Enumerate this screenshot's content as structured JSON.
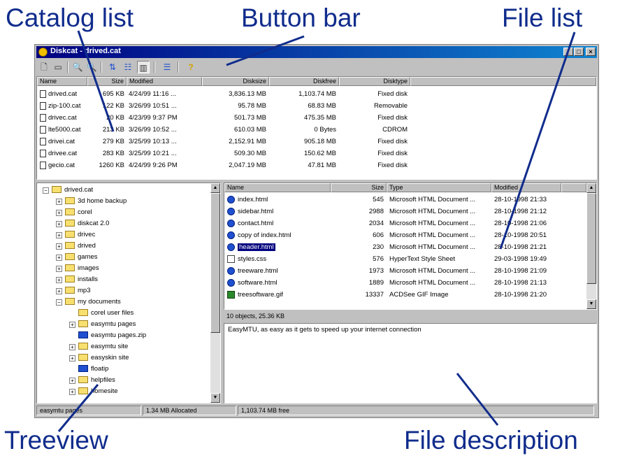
{
  "callouts": {
    "catalog_list": "Catalog list",
    "button_bar": "Button bar",
    "file_list": "File list",
    "treeview": "Treeview",
    "file_description": "File description"
  },
  "window": {
    "title": "Diskcat - drived.cat",
    "minimize": "_",
    "maximize": "□",
    "close": "×"
  },
  "toolbar": {
    "icons": [
      "new-icon",
      "save-icon",
      "search-icon",
      "find-icon",
      "sort-icon",
      "list-view-icon",
      "details-view-icon",
      "options-icon",
      "help-icon"
    ],
    "glyphs": {
      "new": "🗋",
      "save": "▭",
      "search": "🔍",
      "find": "🔍",
      "sort": "⇅",
      "list": "☷",
      "details": "▥",
      "options": "☰",
      "help": "?"
    }
  },
  "catalog": {
    "columns": [
      "Name",
      "Size",
      "Modified",
      "Disksize",
      "Diskfree",
      "Disktype"
    ],
    "rows": [
      {
        "name": "drived.cat",
        "size": "695 KB",
        "modified": "4/24/99 11:16 ...",
        "disksize": "3,836.13 MB",
        "diskfree": "1,103.74 MB",
        "disktype": "Fixed disk"
      },
      {
        "name": "zip-100.cat",
        "size": "122 KB",
        "modified": "3/26/99 10:51 ...",
        "disksize": "95.78 MB",
        "diskfree": "68.83 MB",
        "disktype": "Removable"
      },
      {
        "name": "drivec.cat",
        "size": "20 KB",
        "modified": "4/23/99 9:37 PM",
        "disksize": "501.73 MB",
        "diskfree": "475.35 MB",
        "disktype": "Fixed disk"
      },
      {
        "name": "lte5000.cat",
        "size": "213 KB",
        "modified": "3/26/99 10:52 ...",
        "disksize": "610.03 MB",
        "diskfree": "0 Bytes",
        "disktype": "CDROM"
      },
      {
        "name": "drivei.cat",
        "size": "279 KB",
        "modified": "3/25/99 10:13 ...",
        "disksize": "2,152.91 MB",
        "diskfree": "905.18 MB",
        "disktype": "Fixed disk"
      },
      {
        "name": "drivee.cat",
        "size": "283 KB",
        "modified": "3/25/99 10:21 ...",
        "disksize": "509.30 MB",
        "diskfree": "150.62 MB",
        "disktype": "Fixed disk"
      },
      {
        "name": "gecio.cat",
        "size": "1260 KB",
        "modified": "4/24/99 9:26 PM",
        "disksize": "2,047.19 MB",
        "diskfree": "47.81 MB",
        "disktype": "Fixed disk"
      }
    ]
  },
  "tree": {
    "expander_glyphs": {
      "collapsed": "+",
      "expanded": "−"
    },
    "items": [
      {
        "label": "drived.cat"
      },
      {
        "label": "3d home backup"
      },
      {
        "label": "corel"
      },
      {
        "label": "diskcat 2.0"
      },
      {
        "label": "drivec"
      },
      {
        "label": "drived"
      },
      {
        "label": "games"
      },
      {
        "label": "images"
      },
      {
        "label": "installs"
      },
      {
        "label": "mp3"
      },
      {
        "label": "my documents"
      },
      {
        "label": "corel user files"
      },
      {
        "label": "easymtu pages"
      },
      {
        "label": "easymtu pages.zip"
      },
      {
        "label": "easymtu site"
      },
      {
        "label": "easyskin site"
      },
      {
        "label": "floatip"
      },
      {
        "label": "helpfiles"
      },
      {
        "label": "homesite"
      }
    ]
  },
  "files": {
    "columns": [
      "Name",
      "Size",
      "Type",
      "Modified"
    ],
    "rows": [
      {
        "name": "index.html",
        "size": "545",
        "type": "Microsoft HTML Document ...",
        "modified": "28-10-1998 21:33",
        "icon": "html"
      },
      {
        "name": "sidebar.html",
        "size": "2988",
        "type": "Microsoft HTML Document ...",
        "modified": "28-10-1998 21:12",
        "icon": "html"
      },
      {
        "name": "contact.html",
        "size": "2034",
        "type": "Microsoft HTML Document ...",
        "modified": "28-10-1998 21:06",
        "icon": "html"
      },
      {
        "name": "copy of index.html",
        "size": "606",
        "type": "Microsoft HTML Document ...",
        "modified": "28-10-1998 20:51",
        "icon": "html"
      },
      {
        "name": "header.html",
        "size": "230",
        "type": "Microsoft HTML Document ...",
        "modified": "28-10-1998 21:21",
        "icon": "html",
        "selected": true
      },
      {
        "name": "styles.css",
        "size": "576",
        "type": "HyperText Style Sheet",
        "modified": "29-03-1998 19:49",
        "icon": "txt"
      },
      {
        "name": "treeware.html",
        "size": "1973",
        "type": "Microsoft HTML Document ...",
        "modified": "28-10-1998 21:09",
        "icon": "html"
      },
      {
        "name": "software.html",
        "size": "1889",
        "type": "Microsoft HTML Document ...",
        "modified": "28-10-1998 21:13",
        "icon": "html"
      },
      {
        "name": "treesoftware.gif",
        "size": "13337",
        "type": "ACDSee GIF Image",
        "modified": "28-10-1998 21:20",
        "icon": "gif"
      }
    ],
    "status": "10 objects, 25.36 KB"
  },
  "description": "EasyMTU, as easy as it gets to speed up your internet connection",
  "statusbar": {
    "path": "easymtu pages",
    "allocated": "1.34 MB Allocated",
    "free": "1,103.74 MB free"
  },
  "scroll": {
    "up": "▲",
    "down": "▼"
  },
  "colors": {
    "accent": "#102c8c",
    "selection": "#000080",
    "title_gradient_start": "#000080",
    "title_gradient_end": "#1084d0"
  }
}
